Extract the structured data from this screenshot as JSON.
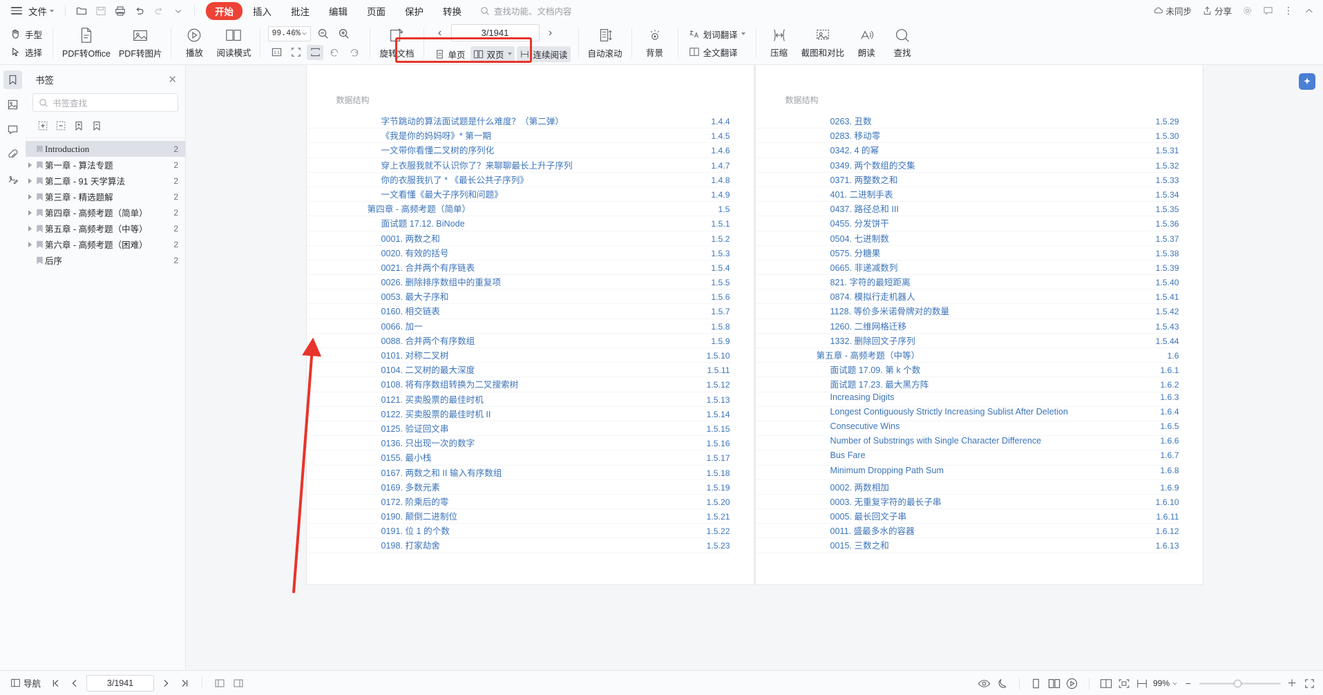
{
  "menubar": {
    "file_label": "文件",
    "tabs": [
      {
        "label": "开始",
        "active": true
      },
      {
        "label": "插入",
        "active": false
      },
      {
        "label": "批注",
        "active": false
      },
      {
        "label": "编辑",
        "active": false
      },
      {
        "label": "页面",
        "active": false
      },
      {
        "label": "保护",
        "active": false
      },
      {
        "label": "转换",
        "active": false
      }
    ],
    "search_placeholder": "查找功能、文档内容",
    "right": {
      "sync_label": "未同步",
      "share_label": "分享"
    }
  },
  "ribbon": {
    "hand_label": "手型",
    "select_label": "选择",
    "pdf_to_office": "PDF转Office",
    "pdf_to_image": "PDF转图片",
    "play_label": "播放",
    "read_mode": "阅读模式",
    "zoom_value": "99.46%",
    "rotate_doc": "旋转文档",
    "single_page": "单页",
    "double_page": "双页",
    "continuous_read": "连续阅读",
    "auto_scroll": "自动滚动",
    "background": "背景",
    "word_translate": "划词翻译",
    "full_translate": "全文翻译",
    "compress": "压缩",
    "screenshot_compare": "截图和对比",
    "read_aloud": "朗读",
    "find": "查找",
    "page_field": "3/1941"
  },
  "sidebar": {
    "rails": [
      {
        "name": "bookmark-rail",
        "active": true
      },
      {
        "name": "thumbnail-rail",
        "active": false
      },
      {
        "name": "comment-rail",
        "active": false
      },
      {
        "name": "attachment-rail",
        "active": false
      },
      {
        "name": "signature-rail",
        "active": false
      }
    ],
    "panel_title": "书签",
    "search_placeholder": "书签查找",
    "tools": [
      "add-bookmark",
      "remove-bookmark",
      "expand-bookmark",
      "collapse-bookmark"
    ],
    "items": [
      {
        "label": "Introduction",
        "page": "2",
        "expandable": false,
        "selected": true,
        "serif": true
      },
      {
        "label": "第一章 - 算法专题",
        "page": "2",
        "expandable": true,
        "selected": false,
        "serif": false
      },
      {
        "label": "第二章 - 91 天学算法",
        "page": "2",
        "expandable": true,
        "selected": false,
        "serif": false
      },
      {
        "label": "第三章 - 精选题解",
        "page": "2",
        "expandable": true,
        "selected": false,
        "serif": false
      },
      {
        "label": "第四章 - 高频考题（简单）",
        "page": "2",
        "expandable": true,
        "selected": false,
        "serif": false
      },
      {
        "label": "第五章 - 高频考题（中等）",
        "page": "2",
        "expandable": true,
        "selected": false,
        "serif": false
      },
      {
        "label": "第六章 - 高频考题（困难）",
        "page": "2",
        "expandable": true,
        "selected": false,
        "serif": false
      },
      {
        "label": "后序",
        "page": "2",
        "expandable": false,
        "selected": false,
        "serif": false
      }
    ]
  },
  "document": {
    "left_page": {
      "header": "数据结构",
      "rows": [
        {
          "title": "字节跳动的算法面试题是什么难度？（第二弹）",
          "num": "1.4.4",
          "level": 2
        },
        {
          "title": "《我是你的妈妈呀》* 第一期",
          "num": "1.4.5",
          "level": 2
        },
        {
          "title": "一文带你看懂二叉树的序列化",
          "num": "1.4.6",
          "level": 2
        },
        {
          "title": "穿上衣服我就不认识你了？来聊聊最长上升子序列",
          "num": "1.4.7",
          "level": 2
        },
        {
          "title": "你的衣服我扒了 * 《最长公共子序列》",
          "num": "1.4.8",
          "level": 2
        },
        {
          "title": "一文看懂《最大子序列和问题》",
          "num": "1.4.9",
          "level": 2
        },
        {
          "title": "第四章 - 高频考题（简单）",
          "num": "1.5",
          "level": 1
        },
        {
          "title": "面试题 17.12. BiNode",
          "num": "1.5.1",
          "level": 2
        },
        {
          "title": "0001. 两数之和",
          "num": "1.5.2",
          "level": 2
        },
        {
          "title": "0020. 有效的括号",
          "num": "1.5.3",
          "level": 2
        },
        {
          "title": "0021. 合并两个有序链表",
          "num": "1.5.4",
          "level": 2
        },
        {
          "title": "0026. 删除排序数组中的重复项",
          "num": "1.5.5",
          "level": 2
        },
        {
          "title": "0053. 最大子序和",
          "num": "1.5.6",
          "level": 2
        },
        {
          "title": "0160. 相交链表",
          "num": "1.5.7",
          "level": 2
        },
        {
          "title": "0066. 加一",
          "num": "1.5.8",
          "level": 2
        },
        {
          "title": "0088. 合并两个有序数组",
          "num": "1.5.9",
          "level": 2
        },
        {
          "title": "0101. 对称二叉树",
          "num": "1.5.10",
          "level": 2
        },
        {
          "title": "0104. 二叉树的最大深度",
          "num": "1.5.11",
          "level": 2
        },
        {
          "title": "0108. 将有序数组转换为二叉搜索树",
          "num": "1.5.12",
          "level": 2
        },
        {
          "title": "0121. 买卖股票的最佳时机",
          "num": "1.5.13",
          "level": 2
        },
        {
          "title": "0122. 买卖股票的最佳时机 II",
          "num": "1.5.14",
          "level": 2
        },
        {
          "title": "0125. 验证回文串",
          "num": "1.5.15",
          "level": 2
        },
        {
          "title": "0136. 只出现一次的数字",
          "num": "1.5.16",
          "level": 2
        },
        {
          "title": "0155. 最小栈",
          "num": "1.5.17",
          "level": 2
        },
        {
          "title": "0167. 两数之和 II 输入有序数组",
          "num": "1.5.18",
          "level": 2
        },
        {
          "title": "0169. 多数元素",
          "num": "1.5.19",
          "level": 2
        },
        {
          "title": "0172. 阶乘后的零",
          "num": "1.5.20",
          "level": 2
        },
        {
          "title": "0190. 颠倒二进制位",
          "num": "1.5.21",
          "level": 2
        },
        {
          "title": "0191. 位 1 的个数",
          "num": "1.5.22",
          "level": 2
        },
        {
          "title": "0198. 打家劫舍",
          "num": "1.5.23",
          "level": 2
        }
      ]
    },
    "right_page": {
      "header": "数据结构",
      "rows": [
        {
          "title": "0263. 丑数",
          "num": "1.5.29",
          "level": 2
        },
        {
          "title": "0283. 移动零",
          "num": "1.5.30",
          "level": 2
        },
        {
          "title": "0342. 4 的幂",
          "num": "1.5.31",
          "level": 2
        },
        {
          "title": "0349. 两个数组的交集",
          "num": "1.5.32",
          "level": 2
        },
        {
          "title": "0371. 两整数之和",
          "num": "1.5.33",
          "level": 2
        },
        {
          "title": "401. 二进制手表",
          "num": "1.5.34",
          "level": 2
        },
        {
          "title": "0437. 路径总和 III",
          "num": "1.5.35",
          "level": 2
        },
        {
          "title": "0455. 分发饼干",
          "num": "1.5.36",
          "level": 2
        },
        {
          "title": "0504. 七进制数",
          "num": "1.5.37",
          "level": 2
        },
        {
          "title": "0575. 分糖果",
          "num": "1.5.38",
          "level": 2
        },
        {
          "title": "0665. 非递减数列",
          "num": "1.5.39",
          "level": 2
        },
        {
          "title": "821. 字符的最短距离",
          "num": "1.5.40",
          "level": 2
        },
        {
          "title": "0874. 模拟行走机器人",
          "num": "1.5.41",
          "level": 2
        },
        {
          "title": "1128. 等价多米诺骨牌对的数量",
          "num": "1.5.42",
          "level": 2
        },
        {
          "title": "1260. 二维网格迁移",
          "num": "1.5.43",
          "level": 2
        },
        {
          "title": "1332. 删除回文子序列",
          "num": "1.5.44",
          "level": 2
        },
        {
          "title": "第五章 - 高频考题（中等）",
          "num": "1.6",
          "level": 1
        },
        {
          "title": "面试题 17.09. 第 k 个数",
          "num": "1.6.1",
          "level": 2
        },
        {
          "title": "面试题 17.23. 最大黑方阵",
          "num": "1.6.2",
          "level": 2
        },
        {
          "title": "Increasing Digits",
          "num": "1.6.3",
          "level": 2
        },
        {
          "title": "Longest Contiguously Strictly Increasing Sublist After Deletion",
          "num": "1.6.4",
          "level": 2
        },
        {
          "title": "Consecutive Wins",
          "num": "1.6.5",
          "level": 2
        },
        {
          "title": "Number of Substrings with Single Character Difference",
          "num": "1.6.6",
          "level": 2
        },
        {
          "title": "Bus Fare",
          "num": "1.6.7",
          "level": 2
        },
        {
          "title": "Minimum Dropping Path Sum",
          "num": "1.6.8",
          "level": 2
        },
        {
          "title": "0002. 两数相加",
          "num": "1.6.9",
          "level": 2
        },
        {
          "title": "0003. 无重复字符的最长子串",
          "num": "1.6.10",
          "level": 2
        },
        {
          "title": "0005. 最长回文子串",
          "num": "1.6.11",
          "level": 2
        },
        {
          "title": "0011. 盛最多水的容器",
          "num": "1.6.12",
          "level": 2
        },
        {
          "title": "0015. 三数之和",
          "num": "1.6.13",
          "level": 2
        }
      ]
    }
  },
  "statusbar": {
    "nav_label": "导航",
    "page_field": "3/1941",
    "zoom_label": "99%"
  },
  "colors": {
    "accent_red": "#ee4236",
    "annotation_red": "#e8342a",
    "link_blue": "#3c74b9",
    "float_blue": "#4a7fd4"
  }
}
